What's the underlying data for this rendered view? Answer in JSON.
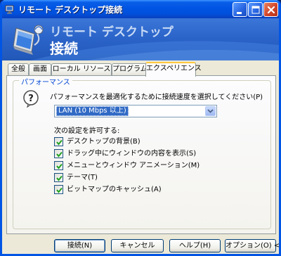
{
  "window": {
    "title": "リモート デスクトップ接続"
  },
  "banner": {
    "line1": "リモート デスクトップ",
    "line2": "接続"
  },
  "tabs": [
    {
      "label": "全般"
    },
    {
      "label": "画面"
    },
    {
      "label": "ローカル リソース"
    },
    {
      "label": "プログラム"
    },
    {
      "label": "エクスペリエンス",
      "active": true
    }
  ],
  "performance": {
    "group_label": "パフォーマンス",
    "description": "パフォーマンスを最適化するために接続速度を選択してください(P)",
    "connection_speed": "LAN (10 Mbps 以上)",
    "allow_label": "次の設定を許可する:",
    "options": [
      {
        "label": "デスクトップの背景(B)",
        "checked": true
      },
      {
        "label": "ドラッグ中にウィンドウの内容を表示(S)",
        "checked": true
      },
      {
        "label": "メニューとウィンドウ アニメーション(M)",
        "checked": true
      },
      {
        "label": "テーマ(T)",
        "checked": true
      },
      {
        "label": "ビットマップのキャッシュ(A)",
        "checked": true
      }
    ]
  },
  "buttons": {
    "connect": "接続(N)",
    "cancel": "キャンセル",
    "help": "ヘルプ(H)",
    "options": "オプション(O) <<"
  },
  "colors": {
    "titlebar": "#0054e3",
    "banner": "#2a63c8",
    "selection": "#316ac5",
    "group_label": "#0046d5"
  }
}
